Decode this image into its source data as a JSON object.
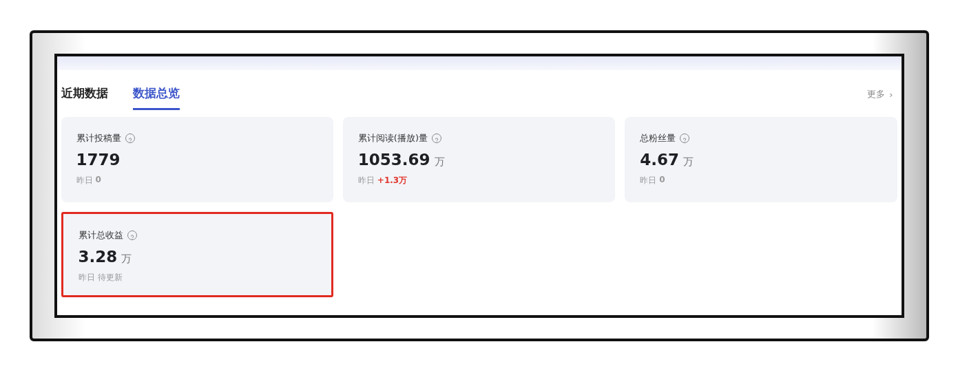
{
  "tabs": [
    {
      "label": "近期数据",
      "selected": false
    },
    {
      "label": "数据总览",
      "selected": true
    }
  ],
  "more_link": {
    "label": "更多",
    "arrow": "›"
  },
  "stats": [
    {
      "title": "累计投稿量",
      "value": "1779",
      "yesterday_label": "昨日",
      "yesterday_value": "0",
      "kind": "flat",
      "highlighted": false
    },
    {
      "title": "累计阅读(播放)量",
      "value": "1053.69",
      "unit": "万",
      "yesterday_label": "昨日",
      "yesterday_value": "+1.3万",
      "kind": "up",
      "highlighted": false
    },
    {
      "title": "总粉丝量",
      "value": "4.67",
      "unit": "万",
      "yesterday_label": "昨日",
      "yesterday_value": "0",
      "kind": "flat",
      "highlighted": false
    },
    {
      "title": "累计总收益",
      "value": "3.28",
      "unit": "万",
      "yesterday_label": "昨日",
      "yesterday_value": "待更新",
      "kind": "pending",
      "highlighted": true
    }
  ]
}
